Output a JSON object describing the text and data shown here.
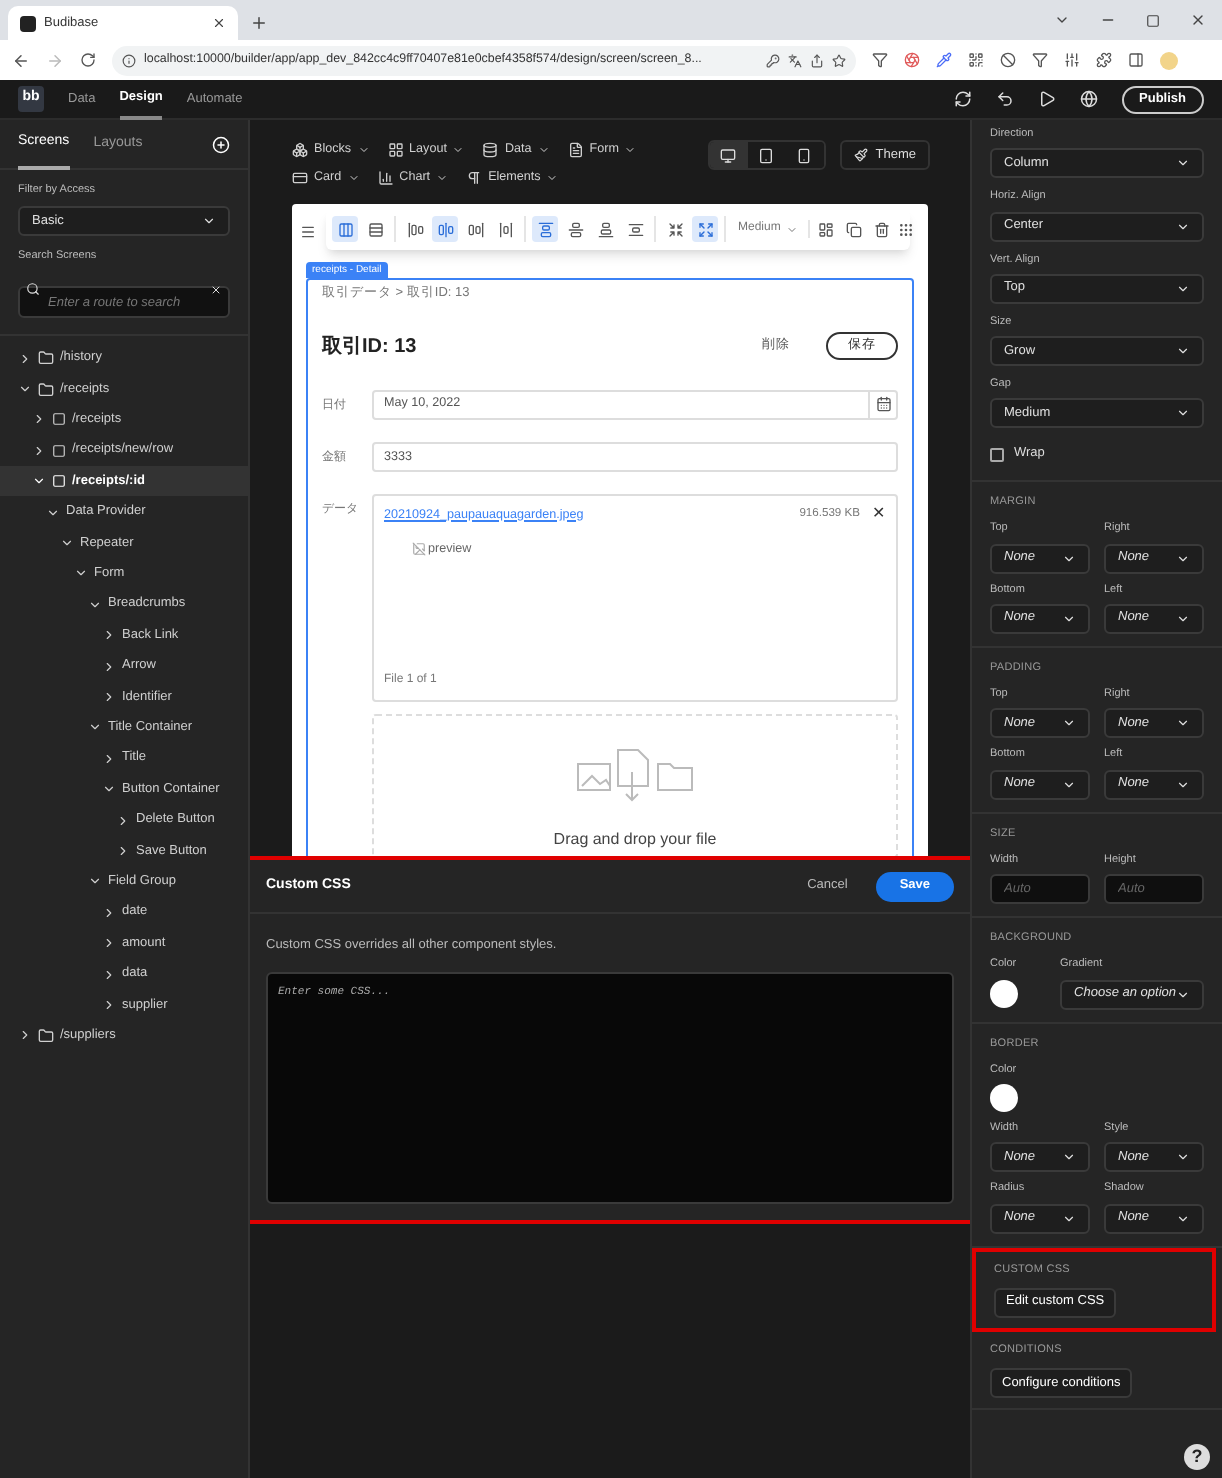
{
  "browser": {
    "tab_title": "Budibase",
    "url": "localhost:10000/builder/app/app_dev_842cc4c9ff70407e81e0cbef4358f574/design/screen/screen_8..."
  },
  "app_nav": {
    "logo_text": "bb",
    "tabs": [
      {
        "label": "Data",
        "selected": false
      },
      {
        "label": "Design",
        "selected": true
      },
      {
        "label": "Automate",
        "selected": false
      }
    ],
    "publish": "Publish"
  },
  "sidebar": {
    "tabs": [
      {
        "label": "Screens",
        "selected": true
      },
      {
        "label": "Layouts",
        "selected": false
      }
    ],
    "filter_label": "Filter by Access",
    "filter_value": "Basic",
    "search_label": "Search Screens",
    "search_placeholder": "Enter a route to search",
    "tree": [
      {
        "label": "/history",
        "kind": "folder",
        "expanded": false,
        "selected": false
      },
      {
        "label": "/receipts",
        "kind": "folder",
        "expanded": true,
        "selected": false,
        "children": [
          {
            "label": "/receipts",
            "kind": "screen",
            "expanded": false,
            "selected": false
          },
          {
            "label": "/receipts/new/row",
            "kind": "screen",
            "expanded": false,
            "selected": false
          },
          {
            "label": "/receipts/:id",
            "kind": "screen",
            "expanded": true,
            "selected": true,
            "children": [
              {
                "label": "Data Provider",
                "expanded": true,
                "selected": false,
                "children": [
                  {
                    "label": "Repeater",
                    "expanded": true,
                    "selected": false,
                    "children": [
                      {
                        "label": "Form",
                        "expanded": true,
                        "selected": false,
                        "children": [
                          {
                            "label": "Breadcrumbs",
                            "expanded": true,
                            "selected": false,
                            "children": [
                              {
                                "label": "Back Link",
                                "expanded": false,
                                "selected": false
                              },
                              {
                                "label": "Arrow",
                                "expanded": false,
                                "selected": false
                              },
                              {
                                "label": "Identifier",
                                "expanded": false,
                                "selected": false
                              }
                            ]
                          },
                          {
                            "label": "Title Container",
                            "expanded": true,
                            "selected": false,
                            "children": [
                              {
                                "label": "Title",
                                "expanded": false,
                                "selected": false
                              },
                              {
                                "label": "Button Container",
                                "expanded": true,
                                "selected": false,
                                "children": [
                                  {
                                    "label": "Delete Button",
                                    "expanded": false,
                                    "selected": false
                                  },
                                  {
                                    "label": "Save Button",
                                    "expanded": false,
                                    "selected": false
                                  }
                                ]
                              }
                            ]
                          },
                          {
                            "label": "Field Group",
                            "expanded": true,
                            "selected": false,
                            "children": [
                              {
                                "label": "date",
                                "expanded": false,
                                "selected": false
                              },
                              {
                                "label": "amount",
                                "expanded": false,
                                "selected": false
                              },
                              {
                                "label": "data",
                                "expanded": false,
                                "selected": false
                              },
                              {
                                "label": "supplier",
                                "expanded": false,
                                "selected": false
                              }
                            ]
                          }
                        ]
                      }
                    ]
                  }
                ]
              }
            ]
          }
        ]
      },
      {
        "label": "/suppliers",
        "kind": "folder",
        "expanded": false,
        "selected": false
      }
    ]
  },
  "toolbar": {
    "menu_rows": [
      [
        {
          "label": "Blocks",
          "kind": "blocks"
        },
        {
          "label": "Layout",
          "kind": "layout"
        },
        {
          "label": "Data",
          "kind": "data"
        },
        {
          "label": "Form",
          "kind": "form"
        }
      ],
      [
        {
          "label": "Card",
          "kind": "card"
        },
        {
          "label": "Chart",
          "kind": "chart"
        },
        {
          "label": "Elements",
          "kind": "elements"
        }
      ]
    ],
    "devices": [
      {
        "kind": "desktop",
        "selected": true
      },
      {
        "kind": "tablet",
        "selected": false
      },
      {
        "kind": "mobile",
        "selected": false
      }
    ],
    "theme": "Theme"
  },
  "canvas": {
    "layout_groups": [
      [
        {
          "kind": "columns",
          "selected": true
        },
        {
          "kind": "rows",
          "selected": false
        }
      ],
      [
        {
          "kind": "align-left",
          "selected": false
        },
        {
          "kind": "align-center",
          "selected": true
        },
        {
          "kind": "align-right",
          "selected": false
        },
        {
          "kind": "spread-h",
          "selected": false
        }
      ],
      [
        {
          "kind": "align-top",
          "selected": true
        },
        {
          "kind": "align-middle",
          "selected": false
        },
        {
          "kind": "align-bottom",
          "selected": false
        },
        {
          "kind": "spread-v",
          "selected": false
        }
      ],
      [
        {
          "kind": "shrink",
          "selected": false
        },
        {
          "kind": "grow",
          "selected": true
        }
      ]
    ],
    "gap_select": "Medium",
    "component_tag": "receipts - Detail",
    "breadcrumb": "取引データ > 取引ID: 13",
    "title": "取引ID: 13",
    "delete": "削除",
    "save": "保存",
    "fields": [
      {
        "kind": "date",
        "label": "日付",
        "value": "May 10, 2022"
      },
      {
        "kind": "text",
        "label": "金額",
        "value": "3333"
      },
      {
        "kind": "file",
        "label": "データ",
        "file_name": "20210924_paupauaquagarden.jpeg",
        "file_size": "916.539 KB",
        "remove": "✕",
        "preview_alt": "preview",
        "file_count": "File 1 of 1",
        "dropzone": "Drag and drop your file"
      }
    ]
  },
  "modal": {
    "title": "Custom CSS",
    "cancel": "Cancel",
    "save": "Save",
    "description": "Custom CSS overrides all other component styles.",
    "placeholder": "Enter some CSS..."
  },
  "settings": {
    "top_fields": [
      {
        "label": "Direction",
        "value": "Column"
      },
      {
        "label": "Horiz. Align",
        "value": "Center"
      },
      {
        "label": "Vert. Align",
        "value": "Top"
      },
      {
        "label": "Size",
        "value": "Grow"
      },
      {
        "label": "Gap",
        "value": "Medium"
      }
    ],
    "wrap": {
      "label": "Wrap",
      "checked": false
    },
    "sections": [
      {
        "kind": "grid",
        "title": "MARGIN",
        "fields": [
          {
            "kind": "select",
            "label": "Top",
            "placeholder": "None"
          },
          {
            "kind": "select",
            "label": "Right",
            "placeholder": "None"
          },
          {
            "kind": "select",
            "label": "Bottom",
            "placeholder": "None"
          },
          {
            "kind": "select",
            "label": "Left",
            "placeholder": "None"
          }
        ]
      },
      {
        "kind": "grid",
        "title": "PADDING",
        "fields": [
          {
            "kind": "select",
            "label": "Top",
            "placeholder": "None"
          },
          {
            "kind": "select",
            "label": "Right",
            "placeholder": "None"
          },
          {
            "kind": "select",
            "label": "Bottom",
            "placeholder": "None"
          },
          {
            "kind": "select",
            "label": "Left",
            "placeholder": "None"
          }
        ]
      },
      {
        "kind": "grid",
        "title": "SIZE",
        "fields": [
          {
            "kind": "input",
            "label": "Width",
            "placeholder": "Auto"
          },
          {
            "kind": "input",
            "label": "Height",
            "placeholder": "Auto"
          }
        ]
      },
      {
        "kind": "grid",
        "title": "BACKGROUND",
        "fields": [
          {
            "kind": "color",
            "label": "Color"
          },
          {
            "kind": "select",
            "label": "Gradient",
            "placeholder": "Choose an option"
          }
        ]
      },
      {
        "kind": "grid",
        "title": "BORDER",
        "fields": [
          {
            "kind": "color",
            "label": "Color"
          },
          {
            "kind": "spacer"
          },
          {
            "kind": "select",
            "label": "Width",
            "placeholder": "None"
          },
          {
            "kind": "select",
            "label": "Style",
            "placeholder": "None"
          },
          {
            "kind": "select",
            "label": "Radius",
            "placeholder": "None"
          },
          {
            "kind": "select",
            "label": "Shadow",
            "placeholder": "None"
          }
        ]
      },
      {
        "kind": "button",
        "title": "CUSTOM CSS",
        "button": "Edit custom CSS",
        "highlighted": true
      },
      {
        "kind": "button",
        "title": "CONDITIONS",
        "button": "Configure conditions",
        "highlighted": false
      }
    ],
    "help": "?"
  }
}
